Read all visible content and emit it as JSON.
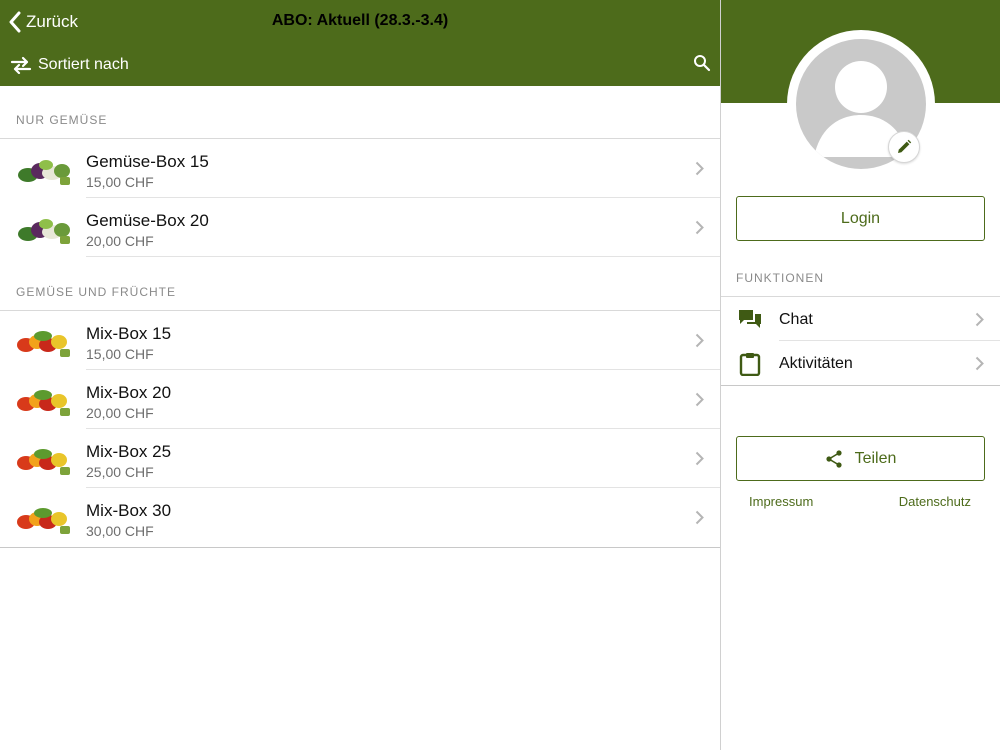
{
  "header": {
    "back_label": "Zurück",
    "title": "ABO: Aktuell (28.3.-3.4)",
    "sort_label": "Sortiert nach",
    "back_icon": "chevron-left-icon",
    "sort_icon": "swap-arrows-icon",
    "search_icon": "search-icon"
  },
  "sections": [
    {
      "title": "NUR GEMÜSE",
      "items": [
        {
          "title": "Gemüse-Box 15",
          "price": "15,00 CHF"
        },
        {
          "title": "Gemüse-Box 20",
          "price": "20,00 CHF"
        }
      ]
    },
    {
      "title": "GEMÜSE UND FRÜCHTE",
      "items": [
        {
          "title": "Mix-Box 15",
          "price": "15,00 CHF"
        },
        {
          "title": "Mix-Box 20",
          "price": "20,00 CHF"
        },
        {
          "title": "Mix-Box 25",
          "price": "25,00 CHF"
        },
        {
          "title": "Mix-Box 30",
          "price": "30,00 CHF"
        }
      ]
    }
  ],
  "profile": {
    "login_label": "Login",
    "functions_header": "FUNKTIONEN",
    "functions": [
      {
        "label": "Chat",
        "icon": "chat-bubbles-icon"
      },
      {
        "label": "Aktivitäten",
        "icon": "clipboard-icon"
      }
    ],
    "share_label": "Teilen",
    "impressum_label": "Impressum",
    "datenschutz_label": "Datenschutz"
  },
  "colors": {
    "brand_green": "#4d6b1b",
    "avatar_grey": "#c9c9c9",
    "separator": "#d9d9d9"
  }
}
